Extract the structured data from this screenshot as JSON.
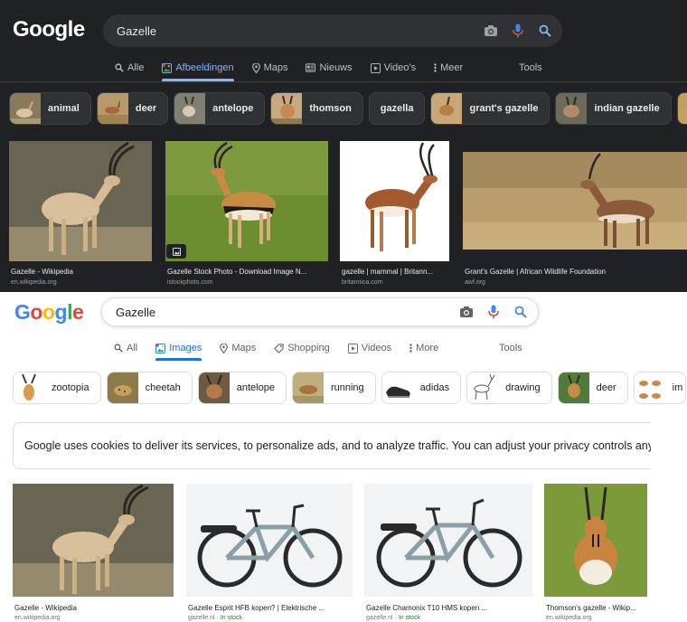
{
  "dark": {
    "search": {
      "value": "Gazelle"
    },
    "tabs": [
      {
        "label": "Alle",
        "icon": "search-icon",
        "active": false
      },
      {
        "label": "Afbeeldingen",
        "icon": "image-icon",
        "active": true
      },
      {
        "label": "Maps",
        "icon": "location-pin-icon",
        "active": false
      },
      {
        "label": "Nieuws",
        "icon": "newspaper-icon",
        "active": false
      },
      {
        "label": "Video's",
        "icon": "play-icon",
        "active": false
      },
      {
        "label": "Meer",
        "icon": "more-vertical-icon",
        "active": false
      }
    ],
    "tools_label": "Tools",
    "chips": [
      "animal",
      "deer",
      "antelope",
      "thomson",
      "gazella",
      "grant's gazelle",
      "indian gazelle"
    ],
    "results": [
      {
        "caption": "Gazelle - Wikipedia",
        "source": "en.wikipedia.org"
      },
      {
        "caption": "Gazelle Stock Photo - Download Image N...",
        "source": "istockphoto.com"
      },
      {
        "caption": "gazelle | mammal | Britann...",
        "source": "britannica.com"
      },
      {
        "caption": "Grant's Gazelle | African Wildlife Foundation",
        "source": "awf.org"
      }
    ]
  },
  "light": {
    "search": {
      "value": "Gazelle"
    },
    "tabs": [
      {
        "label": "All",
        "icon": "search-icon",
        "active": false
      },
      {
        "label": "Images",
        "icon": "image-icon",
        "active": true
      },
      {
        "label": "Maps",
        "icon": "location-pin-icon",
        "active": false
      },
      {
        "label": "Shopping",
        "icon": "tag-icon",
        "active": false
      },
      {
        "label": "Videos",
        "icon": "play-icon",
        "active": false
      },
      {
        "label": "More",
        "icon": "more-vertical-icon",
        "active": false
      }
    ],
    "tools_label": "Tools",
    "chips": [
      "zootopia",
      "cheetah",
      "antelope",
      "running",
      "adidas",
      "drawing",
      "deer",
      "im"
    ],
    "cookie_notice": "Google uses cookies to deliver its services, to personalize ads, and to analyze traffic. You can adjust your privacy controls any",
    "results": [
      {
        "caption": "Gazelle - Wikipedia",
        "source": "en.wikipedia.org",
        "stock": ""
      },
      {
        "caption": "Gazelle Esprit HFB kopen? | Elektrische ...",
        "source": "gazelle.nl",
        "stock": "In stock"
      },
      {
        "caption": "Gazelle Chamonix T10 HMS kopen ...",
        "source": "gazelle.nl",
        "stock": "In stock"
      },
      {
        "caption": "Thomson's gazelle - Wikip...",
        "source": "en.wikipedia.org",
        "stock": ""
      }
    ]
  },
  "logo": {
    "text": "Google",
    "letters": [
      "G",
      "o",
      "o",
      "g",
      "l",
      "e"
    ],
    "colors": [
      "#4285f4",
      "#ea4335",
      "#fbbc05",
      "#4285f4",
      "#34a853",
      "#ea4335"
    ]
  },
  "colors": {
    "dark_bg": "#202124",
    "accent_dark": "#8ab4f8",
    "accent_light": "#1a73e8",
    "stock_green": "#188038"
  }
}
